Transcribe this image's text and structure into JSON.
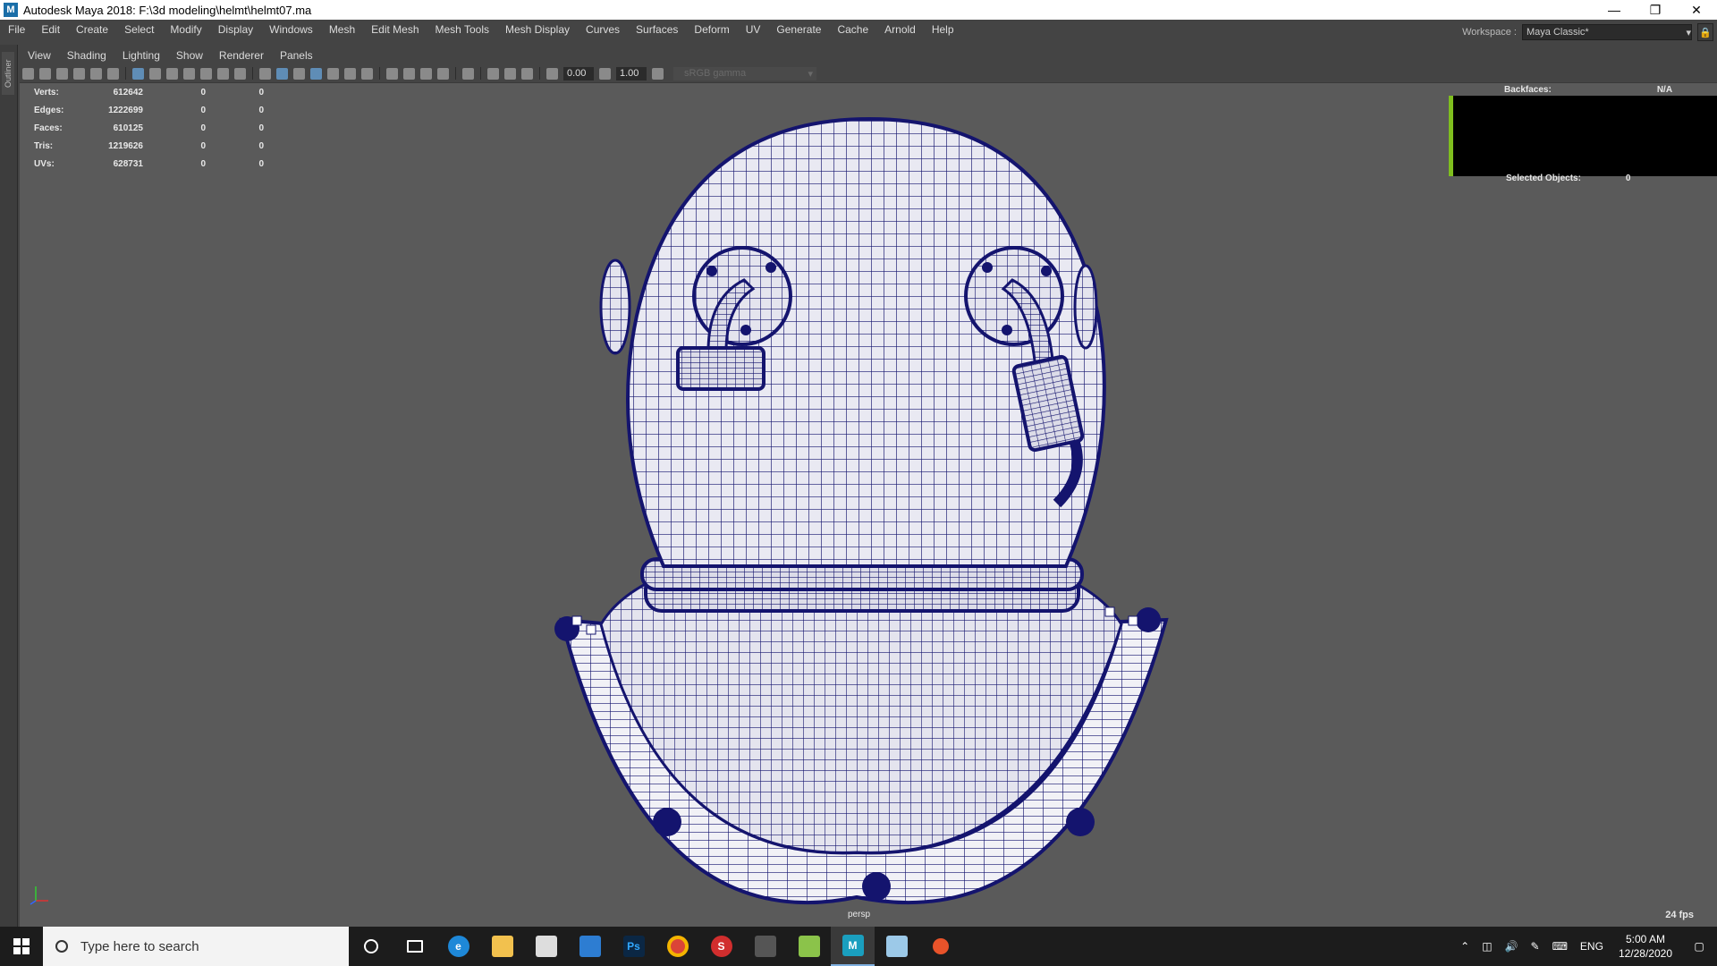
{
  "window": {
    "title": "Autodesk Maya 2018: F:\\3d modeling\\helmt\\helmt07.ma",
    "app_icon": "M",
    "controls": [
      "minimize-icon",
      "restore-icon",
      "close-icon"
    ]
  },
  "menubar": [
    "File",
    "Edit",
    "Create",
    "Select",
    "Modify",
    "Display",
    "Windows",
    "Mesh",
    "Edit Mesh",
    "Mesh Tools",
    "Mesh Display",
    "Curves",
    "Surfaces",
    "Deform",
    "UV",
    "Generate",
    "Cache",
    "Arnold",
    "Help"
  ],
  "workspace": {
    "label": "Workspace :",
    "value": "Maya Classic*"
  },
  "outliner_tab": "Outliner",
  "panel_menu": [
    "View",
    "Shading",
    "Lighting",
    "Show",
    "Renderer",
    "Panels"
  ],
  "panel_toolbar": {
    "exposure": "0.00",
    "gamma": "1.00",
    "color_space": "sRGB gamma"
  },
  "hud": {
    "stats": [
      {
        "label": "Verts:",
        "v1": "612642",
        "v2": "0",
        "v3": "0"
      },
      {
        "label": "Edges:",
        "v1": "1222699",
        "v2": "0",
        "v3": "0"
      },
      {
        "label": "Faces:",
        "v1": "610125",
        "v2": "0",
        "v3": "0"
      },
      {
        "label": "Tris:",
        "v1": "1219626",
        "v2": "0",
        "v3": "0"
      },
      {
        "label": "UVs:",
        "v1": "628731",
        "v2": "0",
        "v3": "0"
      }
    ],
    "backfaces_label": "Backfaces:",
    "backfaces_value": "N/A",
    "selected_label": "Selected Objects:",
    "selected_value": "0",
    "camera": "persp",
    "fps": "24 fps"
  },
  "taskbar": {
    "search_placeholder": "Type here to search",
    "language": "ENG",
    "time": "5:00 AM",
    "date": "12/28/2020",
    "apps": [
      "cortana-icon",
      "task-view-icon",
      "edge-icon",
      "file-explorer-icon",
      "store-icon",
      "mail-icon",
      "photoshop-icon",
      "chrome-icon",
      "substance-icon",
      "app-icon",
      "maps-icon",
      "maya-icon",
      "app-icon-2",
      "app-icon-3"
    ]
  },
  "colors": {
    "viewport_bg": "#5a5a5a",
    "wire": "#14146e",
    "mesh": "#ececf4",
    "accent_green": "#7fbf1e"
  }
}
